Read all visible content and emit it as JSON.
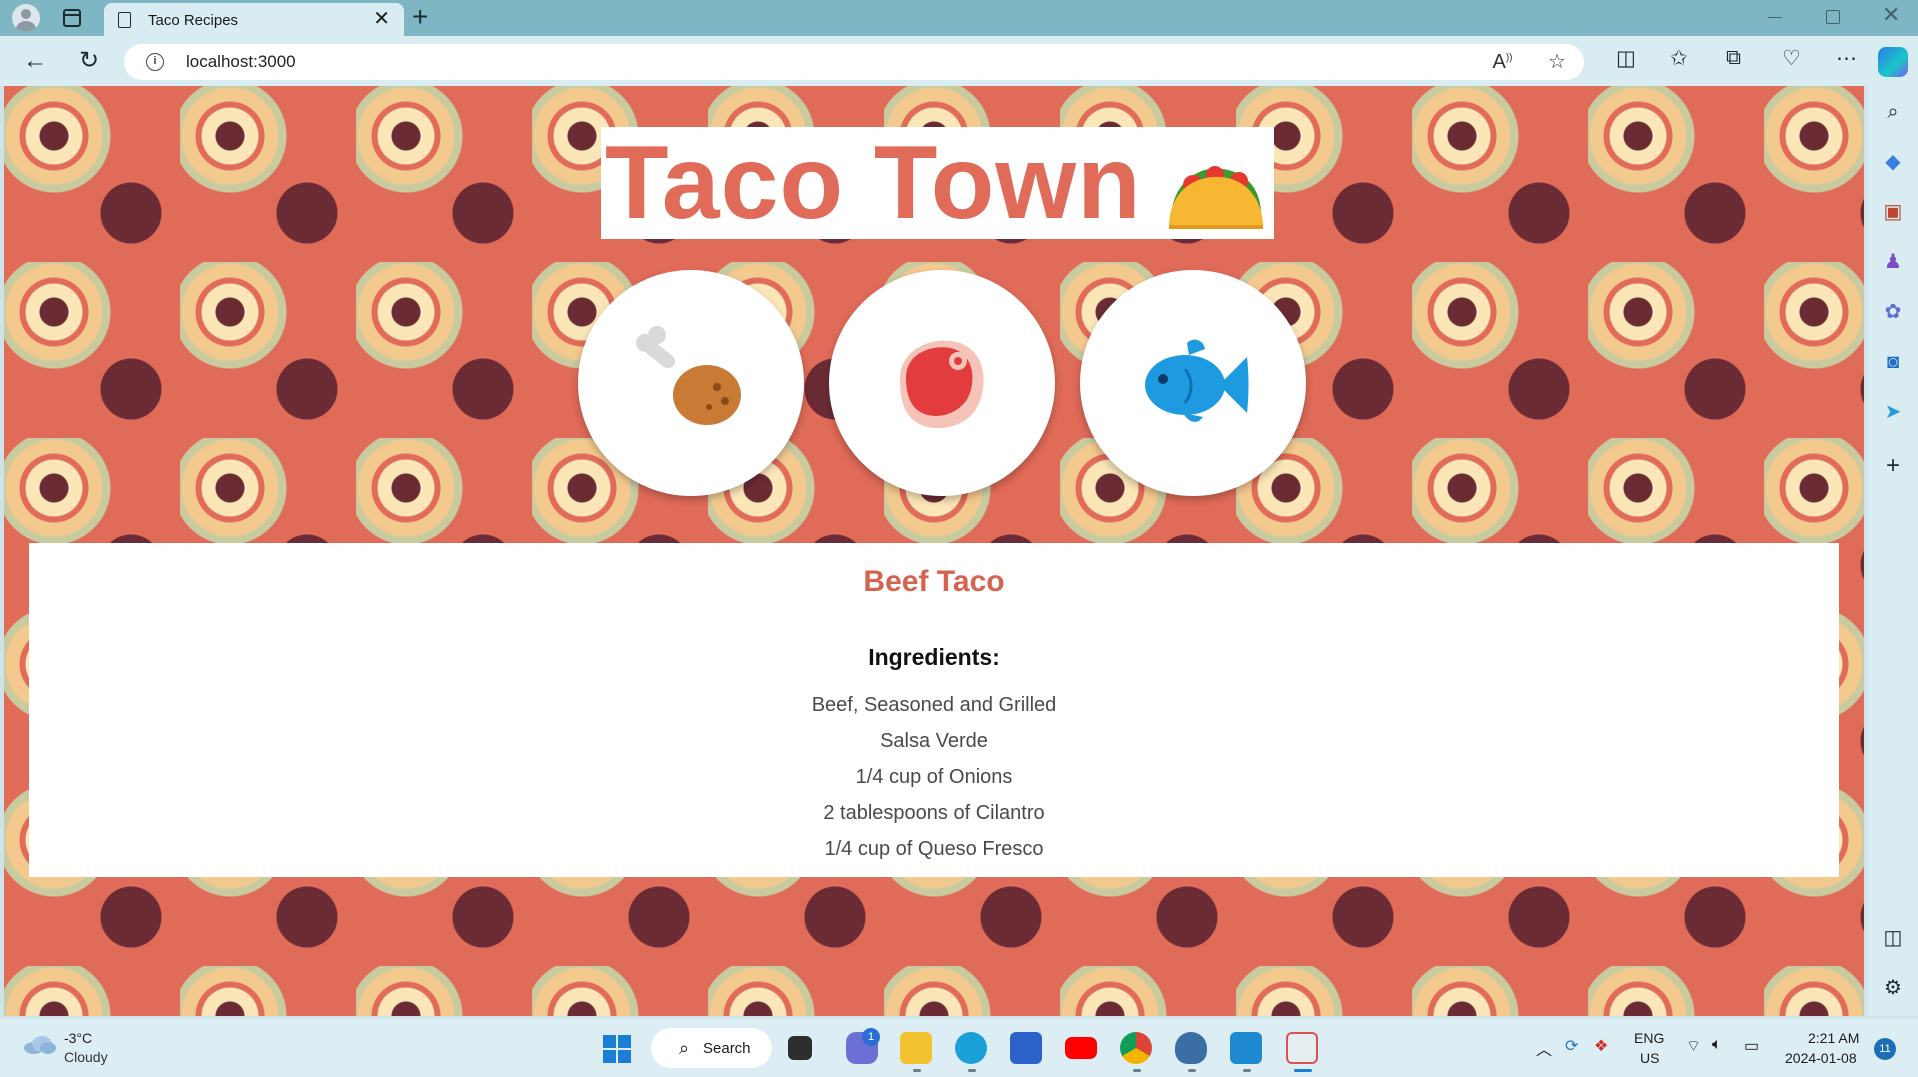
{
  "browser": {
    "tab_title": "Taco Recipes",
    "close_tab": "✕",
    "new_tab": "+",
    "url": "localhost:3000"
  },
  "page": {
    "heading": "Taco Town",
    "categories": [
      {
        "name": "chicken",
        "icon": "poultry-leg-icon"
      },
      {
        "name": "beef",
        "icon": "cut-of-meat-icon"
      },
      {
        "name": "fish",
        "icon": "fish-icon"
      }
    ],
    "recipe": {
      "title": "Beef Taco",
      "ingredients_heading": "Ingredients:",
      "ingredients": [
        "Beef, Seasoned and Grilled",
        "Salsa Verde",
        "1/4 cup of Onions",
        "2 tablespoons of Cilantro",
        "1/4 cup of Queso Fresco"
      ]
    },
    "colors": {
      "accent": "#e06b58",
      "pattern_dark": "#6b2b35",
      "pattern_cream": "#fbe6b8",
      "pattern_sage": "#c8caa0"
    }
  },
  "taskbar": {
    "weather_temp": "-3°C",
    "weather_condition": "Cloudy",
    "search_label": "Search",
    "chat_badge": "1",
    "language_line1": "ENG",
    "language_line2": "US",
    "time": "2:21 AM",
    "date": "2024-01-08",
    "notification_count": "11"
  }
}
